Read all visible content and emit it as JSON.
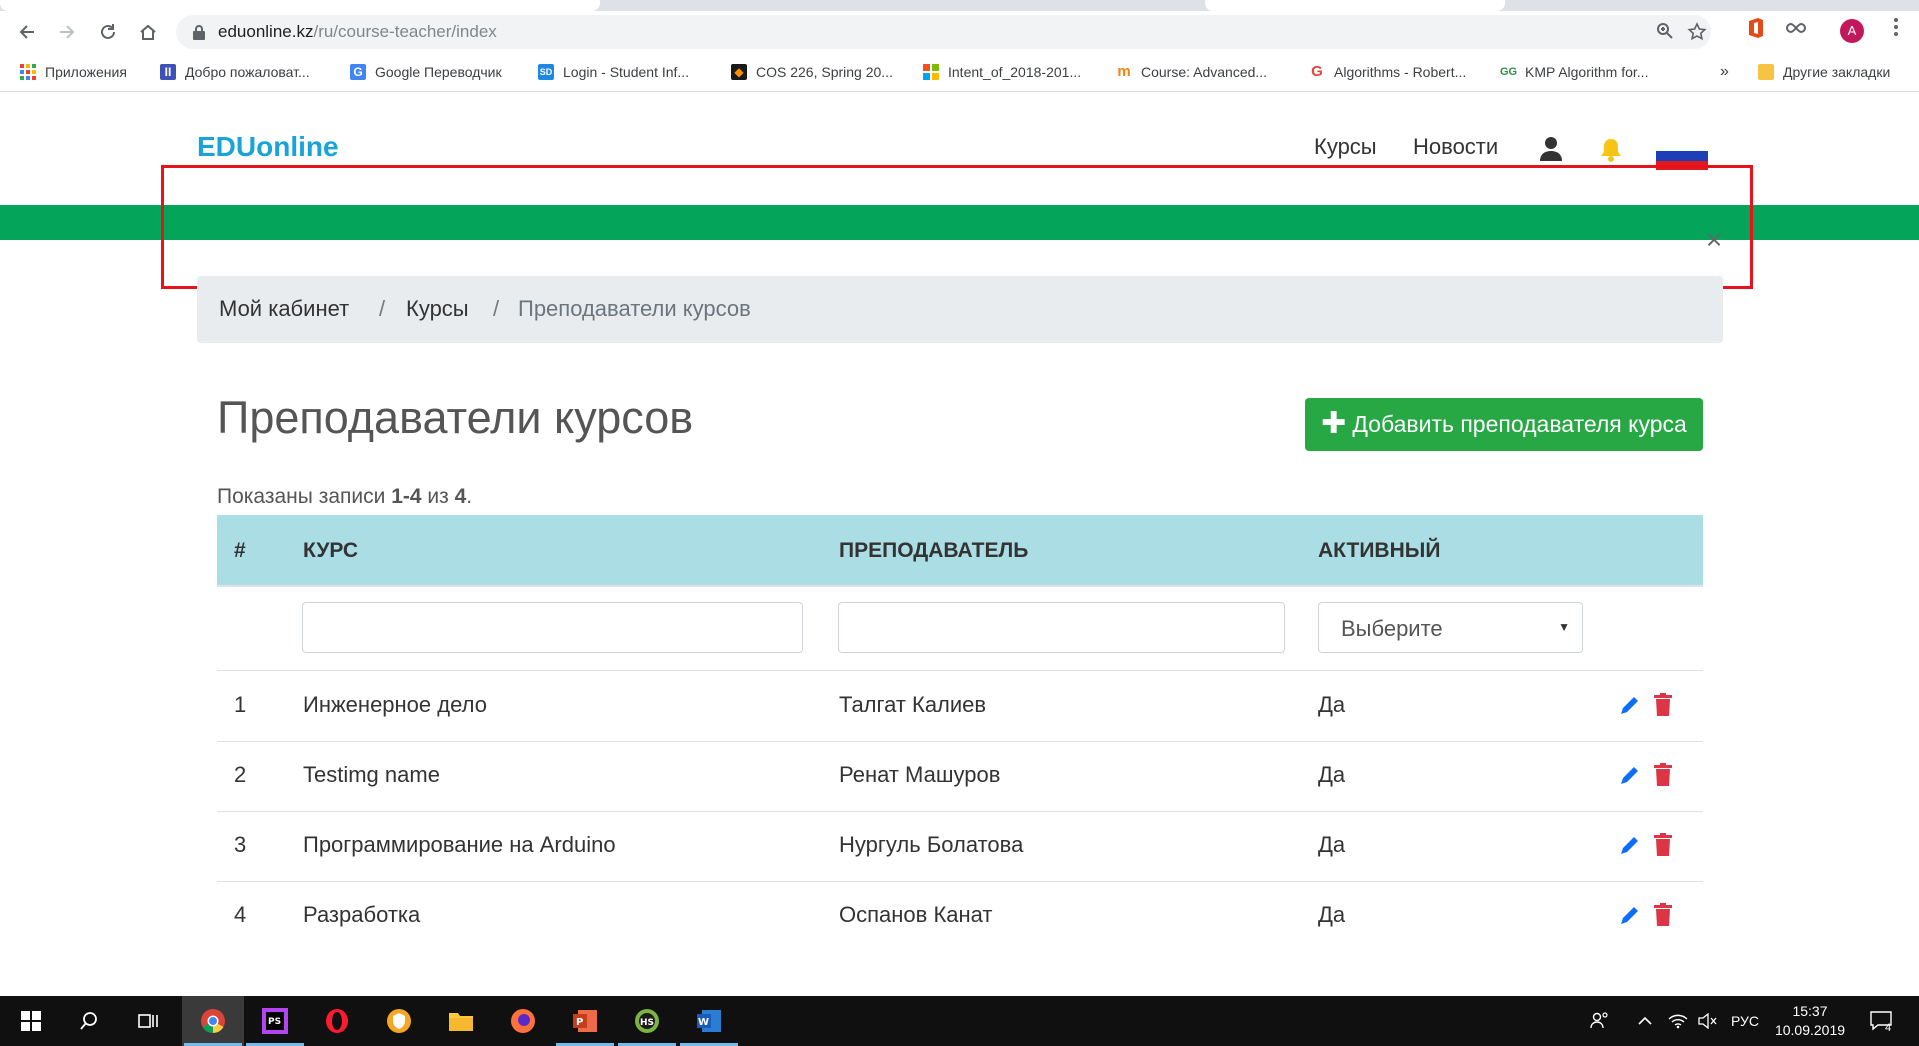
{
  "browser": {
    "url_host": "eduonline.kz",
    "url_path": "/ru/course-teacher/index",
    "avatar_letter": "A",
    "bookmarks": [
      {
        "label": "Приложения",
        "icon": "apps-grid-icon"
      },
      {
        "label": "Добро пожаловат...",
        "icon": "site-icon"
      },
      {
        "label": "Google Переводчик",
        "icon": "google-translate-icon"
      },
      {
        "label": "Login - Student Inf...",
        "icon": "site-icon"
      },
      {
        "label": "COS 226, Spring 20...",
        "icon": "princeton-shield-icon"
      },
      {
        "label": "Intent_of_2018-201...",
        "icon": "microsoft-icon"
      },
      {
        "label": "Course: Advanced...",
        "icon": "moodle-icon"
      },
      {
        "label": "Algorithms - Robert...",
        "icon": "google-icon"
      },
      {
        "label": "KMP Algorithm for...",
        "icon": "geeksforgeeks-icon"
      }
    ],
    "more_bookmarks": "»",
    "other_bookmarks": "Другие закладки"
  },
  "site": {
    "logo": "EDUonline",
    "nav": {
      "courses": "Курсы",
      "news": "Новости"
    },
    "flag_colors": [
      "#ffffff",
      "#1c3fb7",
      "#e0191d"
    ],
    "close_symbol": "×"
  },
  "breadcrumb": {
    "home": "Мой кабинет",
    "courses": "Курсы",
    "current": "Преподаватели курсов",
    "separator": "/"
  },
  "page": {
    "title": "Преподаватели курсов",
    "add_button": "Добавить преподавателя курса",
    "summary_prefix": "Показаны записи ",
    "summary_range": "1-4",
    "summary_mid": " из ",
    "summary_total": "4",
    "summary_suffix": "."
  },
  "table": {
    "headers": {
      "num": "#",
      "course": "КУРС",
      "teacher": "ПРЕПОДАВАТЕЛЬ",
      "active": "АКТИВНЫЙ"
    },
    "filter_select": "Выберите",
    "rows": [
      {
        "num": "1",
        "course": "Инженерное дело",
        "teacher": "Талгат Калиев",
        "active": "Да"
      },
      {
        "num": "2",
        "course": "Testimg name",
        "teacher": "Ренат Машуров",
        "active": "Да"
      },
      {
        "num": "3",
        "course": "Программирование на Arduino",
        "teacher": "Нургуль Болатова",
        "active": "Да"
      },
      {
        "num": "4",
        "course": "Разработка",
        "teacher": "Оспанов Канат",
        "active": "Да"
      }
    ]
  },
  "taskbar": {
    "language": "РУС",
    "time": "15:37",
    "date": "10.09.2019",
    "notifications": "4"
  },
  "colors": {
    "accent_green": "#04a45a",
    "button_green": "#28a745",
    "header_blue": "#abdde5",
    "logo_blue": "#1aa3d9",
    "highlight_red": "#e8121b",
    "edit_blue": "#0d6efd",
    "delete_red": "#dc3545"
  }
}
